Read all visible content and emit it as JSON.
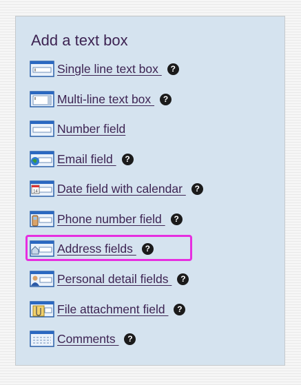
{
  "panel": {
    "title": "Add a text box",
    "items": [
      {
        "label": "Single line text box ",
        "icon": "single-line-textbox-icon"
      },
      {
        "label": "Multi-line text box ",
        "icon": "multi-line-textbox-icon"
      },
      {
        "label": "Number field",
        "icon": "number-field-icon"
      },
      {
        "label": "Email field ",
        "icon": "email-field-icon"
      },
      {
        "label": "Date field with calendar ",
        "icon": "date-calendar-icon"
      },
      {
        "label": "Phone number field ",
        "icon": "phone-field-icon"
      },
      {
        "label": "Address fields ",
        "icon": "address-fields-icon"
      },
      {
        "label": "Personal detail fields ",
        "icon": "personal-detail-icon"
      },
      {
        "label": "File attachment field ",
        "icon": "file-attachment-icon"
      },
      {
        "label": "Comments ",
        "icon": "comments-icon"
      }
    ],
    "help_symbol": "?",
    "highlight_color": "#e62ee0"
  }
}
